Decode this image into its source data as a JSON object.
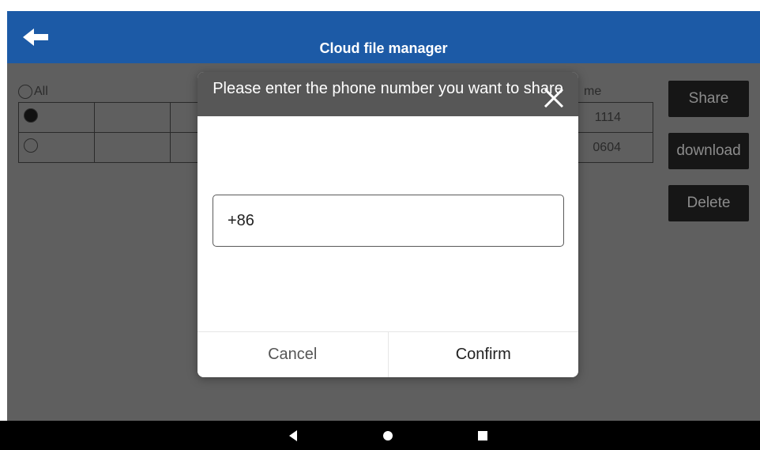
{
  "titlebar": {
    "title": "Cloud file manager",
    "back_icon": "arrow-left-icon"
  },
  "list": {
    "select_all_label": "All",
    "column_header_fragment": "me",
    "rows": [
      {
        "selected": true,
        "time_fragment": "1114"
      },
      {
        "selected": false,
        "time_fragment": "0604"
      }
    ]
  },
  "actions": {
    "share": "Share",
    "download": "download",
    "delete": "Delete"
  },
  "dialog": {
    "title": "Please enter the phone number you want to share",
    "input_value": "+86",
    "cancel": "Cancel",
    "confirm": "Confirm",
    "close_icon": "close-icon"
  },
  "colors": {
    "titlebar": "#1c5aa6",
    "dialog_header": "#575757",
    "dim_overlay": "#5f5f5f",
    "button_bg": "#161616"
  },
  "navbar": {
    "back_icon": "nav-back-icon",
    "home_icon": "nav-home-icon",
    "recents_icon": "nav-recents-icon"
  }
}
